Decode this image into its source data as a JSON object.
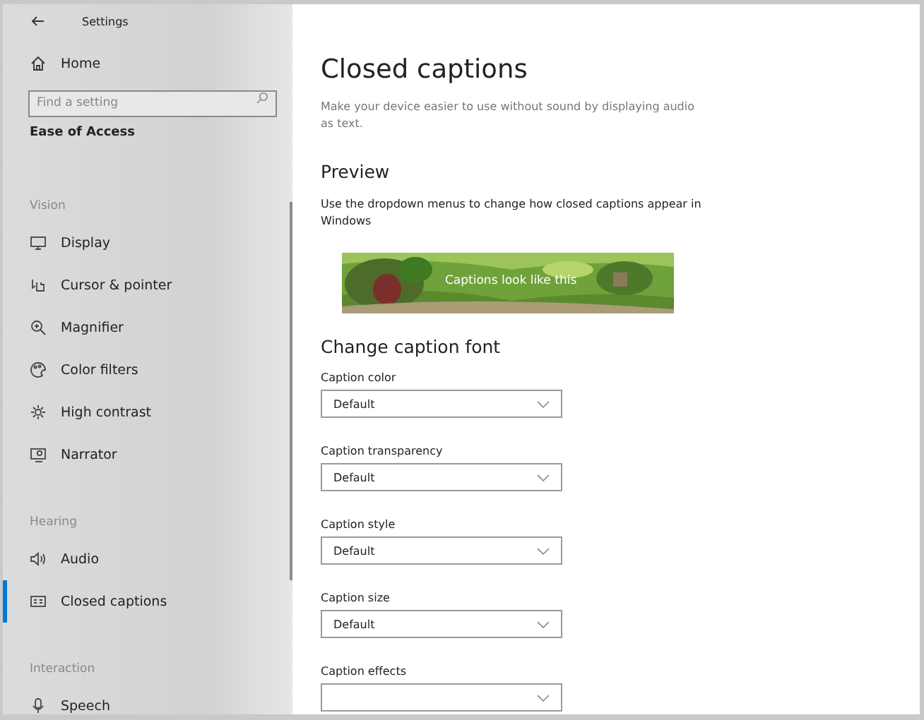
{
  "window": {
    "title": "Settings"
  },
  "sidebar": {
    "home": "Home",
    "search": {
      "placeholder": "Find a setting"
    },
    "category": "Ease of Access",
    "sections": [
      {
        "heading": "Vision",
        "items": [
          {
            "label": "Display",
            "selected": false
          },
          {
            "label": "Cursor & pointer",
            "selected": false
          },
          {
            "label": "Magnifier",
            "selected": false
          },
          {
            "label": "Color filters",
            "selected": false
          },
          {
            "label": "High contrast",
            "selected": false
          },
          {
            "label": "Narrator",
            "selected": false
          }
        ]
      },
      {
        "heading": "Hearing",
        "items": [
          {
            "label": "Audio",
            "selected": false
          },
          {
            "label": "Closed captions",
            "selected": true
          }
        ]
      },
      {
        "heading": "Interaction",
        "items": [
          {
            "label": "Speech",
            "selected": false
          }
        ]
      }
    ]
  },
  "content": {
    "title": "Closed captions",
    "description": "Make your device easier to use without sound by displaying audio as text.",
    "preview": {
      "heading": "Preview",
      "description": "Use the dropdown menus to change how closed captions appear in Windows",
      "caption": "Captions look like this"
    },
    "font_section": {
      "heading": "Change caption font",
      "dropdowns": [
        {
          "label": "Caption color",
          "value": "Default"
        },
        {
          "label": "Caption transparency",
          "value": "Default"
        },
        {
          "label": "Caption style",
          "value": "Default"
        },
        {
          "label": "Caption size",
          "value": "Default"
        },
        {
          "label": "Caption effects"
        }
      ]
    }
  }
}
